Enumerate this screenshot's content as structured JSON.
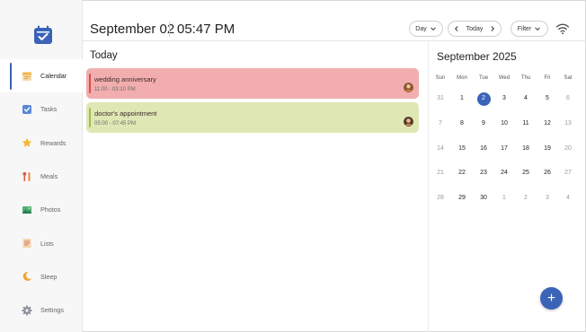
{
  "header": {
    "date": "September 02",
    "time": "05:47 PM",
    "view_select": "Day",
    "today_button": "Today",
    "filter_button": "Filter"
  },
  "sidebar": {
    "items": [
      {
        "label": "Calendar",
        "icon": "calendar-icon"
      },
      {
        "label": "Tasks",
        "icon": "checkbox-icon"
      },
      {
        "label": "Rewards",
        "icon": "star-icon"
      },
      {
        "label": "Meals",
        "icon": "utensils-icon"
      },
      {
        "label": "Photos",
        "icon": "photo-icon"
      },
      {
        "label": "Lists",
        "icon": "list-icon"
      },
      {
        "label": "Sleep",
        "icon": "moon-icon"
      },
      {
        "label": "Settings",
        "icon": "gear-icon"
      }
    ]
  },
  "today": {
    "title": "Today",
    "events": [
      {
        "title": "wedding anniversary",
        "time": "11:00 - 03:10 PM",
        "bg": "#f2aeae",
        "accent": "#e04a4a"
      },
      {
        "title": "doctor's appointment",
        "time": "05:00 - 07:45 PM",
        "bg": "#dfe8b4",
        "accent": "#9dc04a"
      }
    ]
  },
  "calendar": {
    "title": "September 2025",
    "weekdays": [
      "Sun",
      "Mon",
      "Tue",
      "Wed",
      "Thu",
      "Fri",
      "Sat"
    ],
    "weeks": [
      [
        "31",
        "1",
        "2",
        "3",
        "4",
        "5",
        "6"
      ],
      [
        "7",
        "8",
        "9",
        "10",
        "11",
        "12",
        "13"
      ],
      [
        "14",
        "15",
        "16",
        "17",
        "18",
        "19",
        "20"
      ],
      [
        "21",
        "22",
        "23",
        "24",
        "25",
        "26",
        "27"
      ],
      [
        "28",
        "29",
        "30",
        "1",
        "2",
        "3",
        "4"
      ]
    ],
    "selected_day": "2"
  },
  "fab": {
    "label": "+"
  },
  "colors": {
    "accent": "#3b63b8"
  }
}
